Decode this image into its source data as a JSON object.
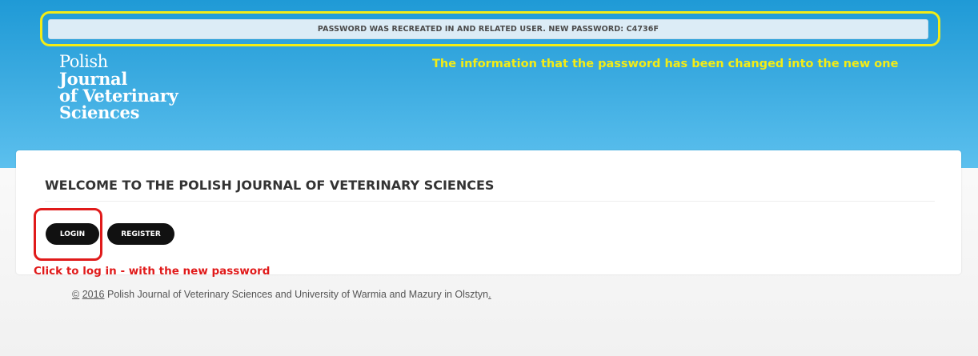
{
  "flash": {
    "message": "PASSWORD WAS RECREATED IN AND RELATED USER. NEW PASSWORD: C4736F"
  },
  "annotations": {
    "top_note": "The information that the password has been changed into the new one",
    "login_note": "Click to log in - with the new password",
    "colors": {
      "yellow": "#f4ec15",
      "red": "#e01a1a"
    }
  },
  "logo": {
    "line1": "Polish",
    "line2": "Journal",
    "line3": "of Veterinary",
    "line4": "Sciences"
  },
  "main": {
    "heading": "WELCOME TO THE POLISH JOURNAL OF VETERINARY SCIENCES",
    "login_label": "LOGIN",
    "register_label": "REGISTER"
  },
  "footer": {
    "copyright_symbol": "©",
    "year": "2016",
    "text": " Polish Journal of Veterinary Sciences and University of Warmia and Mazury in Olsztyn",
    "trailing_link": "."
  },
  "theme": {
    "header_blue": "#1f9ad6",
    "button_black": "#111111"
  }
}
